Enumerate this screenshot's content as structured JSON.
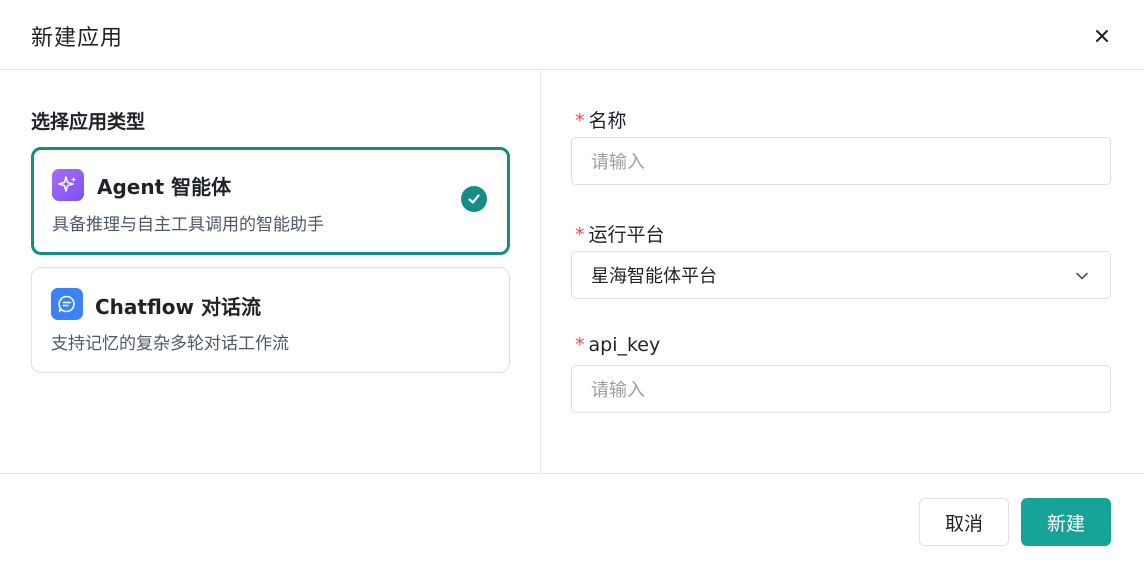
{
  "dialog": {
    "title": "新建应用",
    "close_icon": "close-icon"
  },
  "app_type": {
    "section_title": "选择应用类型",
    "options": [
      {
        "name": "Agent 智能体",
        "description": "具备推理与自主工具调用的智能助手",
        "icon": "sparkle-icon",
        "selected": true
      },
      {
        "name": "Chatflow 对话流",
        "description": "支持记忆的复杂多轮对话工作流",
        "icon": "chat-bubble-icon",
        "selected": false
      }
    ]
  },
  "form": {
    "required_mark": "*",
    "name": {
      "label": "名称",
      "placeholder": "请输入",
      "value": ""
    },
    "platform": {
      "label": "运行平台",
      "value": "星海智能体平台"
    },
    "api_key": {
      "label": "api_key",
      "placeholder": "请输入",
      "value": ""
    }
  },
  "footer": {
    "cancel_label": "取消",
    "create_label": "新建"
  },
  "colors": {
    "accent": "#17a398",
    "selected_border": "#168c86",
    "required": "#f04848"
  }
}
